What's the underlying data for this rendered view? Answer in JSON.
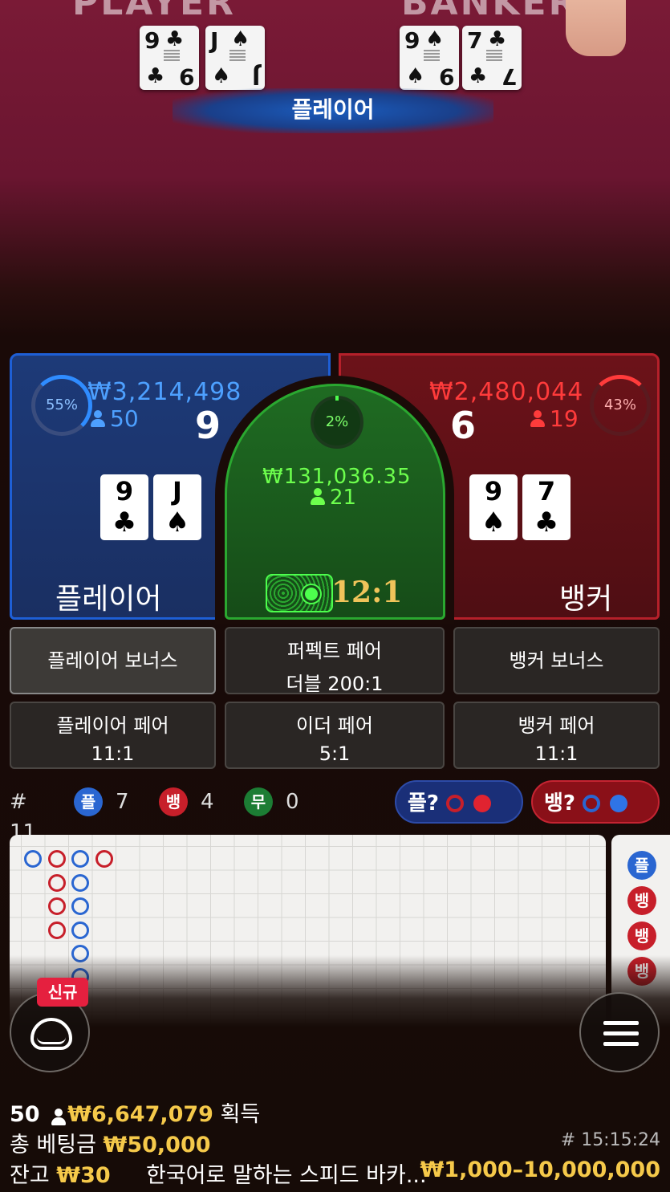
{
  "video": {
    "felt_left_text": "PLAYER",
    "felt_right_text": "BANKER",
    "player_cards": [
      {
        "rank": "9",
        "suit": "♣"
      },
      {
        "rank": "J",
        "suit": "♠"
      }
    ],
    "banker_cards": [
      {
        "rank": "9",
        "suit": "♠"
      },
      {
        "rank": "7",
        "suit": "♣"
      }
    ],
    "result_label": "플레이어"
  },
  "player": {
    "percent": "55%",
    "amount": "₩3,214,498",
    "count": "50",
    "score": "9",
    "cards": [
      {
        "rank": "9",
        "suit": "♣"
      },
      {
        "rank": "J",
        "suit": "♠"
      }
    ],
    "label": "플레이어"
  },
  "tie": {
    "percent": "2%",
    "amount": "₩131,036.35",
    "count": "21",
    "payout": "12:1"
  },
  "banker": {
    "percent": "43%",
    "amount": "₩2,480,044",
    "count": "19",
    "score": "6",
    "cards": [
      {
        "rank": "9",
        "suit": "♠"
      },
      {
        "rank": "7",
        "suit": "♣"
      }
    ],
    "label": "뱅커"
  },
  "side_bets": {
    "player_bonus": "플레이어 보너스",
    "perfect_pair": "퍼펙트 페어",
    "perfect_pair_odds": "더블 200:1",
    "banker_bonus": "뱅커 보너스",
    "player_pair": "플레이어 페어",
    "player_pair_odds": "11:1",
    "either_pair": "이더 페어",
    "either_pair_odds": "5:1",
    "banker_pair": "뱅커 페어",
    "banker_pair_odds": "11:1"
  },
  "stats": {
    "round_label": "# 11",
    "player_chip": "플",
    "player_count": "7",
    "banker_chip": "뱅",
    "banker_count": "4",
    "tie_chip": "무",
    "tie_count": "0",
    "player_predict": "플?",
    "banker_predict": "뱅?"
  },
  "side_road": [
    "플",
    "뱅",
    "뱅",
    "뱅"
  ],
  "lobby": {
    "new_badge": "신규"
  },
  "footer": {
    "players": "50",
    "winnings": "₩6,647,079",
    "winnings_label": "획득",
    "total_bet_label": "총 베팅금",
    "total_bet": "₩50,000",
    "time": "# 15:15:24",
    "balance_label": "잔고",
    "balance": "₩30",
    "table_name": "한국어로 말하는 스피드 바카...",
    "limits": "₩1,000–10,000,000"
  },
  "colors": {
    "player": "#1e5fd6",
    "banker": "#b5202a",
    "tie": "#2aa830",
    "gold": "#f5c94a"
  }
}
